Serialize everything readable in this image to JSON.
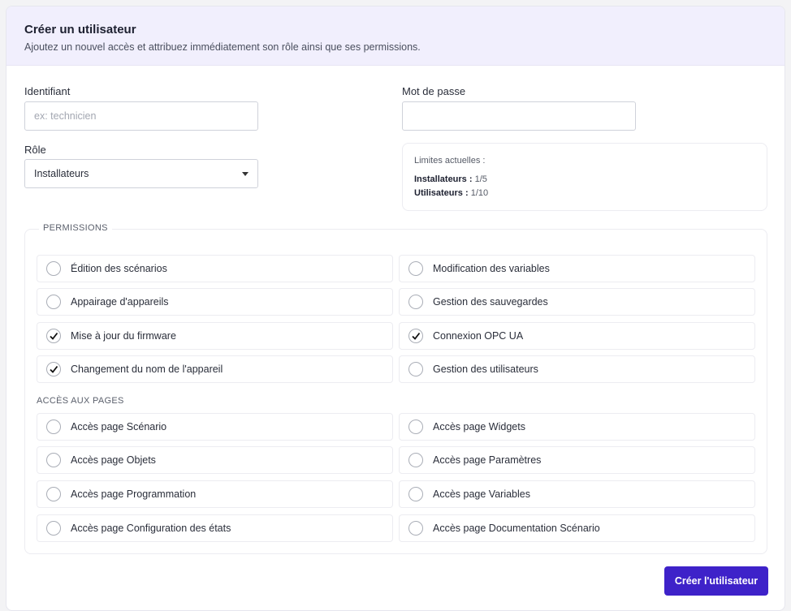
{
  "header": {
    "title": "Créer un utilisateur",
    "subtitle": "Ajoutez un nouvel accès et attribuez immédiatement son rôle ainsi que ses permissions."
  },
  "form": {
    "identifier_label": "Identifiant",
    "identifier_value": "",
    "identifier_placeholder": "ex: technicien",
    "password_label": "Mot de passe",
    "password_value": "",
    "role_label": "Rôle",
    "role_value": "Installateurs"
  },
  "limits": {
    "title": "Limites actuelles :",
    "rows": [
      {
        "label": "Installateurs :",
        "value": "1/5"
      },
      {
        "label": "Utilisateurs :",
        "value": "1/10"
      }
    ]
  },
  "permissions": {
    "title": "PERMISSIONS",
    "items": [
      {
        "label": "Édition des scénarios",
        "checked": false
      },
      {
        "label": "Modification des variables",
        "checked": false
      },
      {
        "label": "Appairage d'appareils",
        "checked": false
      },
      {
        "label": "Gestion des sauvegardes",
        "checked": false
      },
      {
        "label": "Mise à jour du firmware",
        "checked": true
      },
      {
        "label": "Connexion OPC UA",
        "checked": true
      },
      {
        "label": "Changement du nom de l'appareil",
        "checked": true
      },
      {
        "label": "Gestion des utilisateurs",
        "checked": false
      }
    ]
  },
  "pages": {
    "title": "ACCÈS AUX PAGES",
    "items": [
      {
        "label": "Accès page Scénario",
        "checked": false
      },
      {
        "label": "Accès page Widgets",
        "checked": false
      },
      {
        "label": "Accès page Objets",
        "checked": false
      },
      {
        "label": "Accès page Paramètres",
        "checked": false
      },
      {
        "label": "Accès page Programmation",
        "checked": false
      },
      {
        "label": "Accès page Variables",
        "checked": false
      },
      {
        "label": "Accès page Configuration des états",
        "checked": false
      },
      {
        "label": "Accès page Documentation Scénario",
        "checked": false
      }
    ]
  },
  "submit_label": "Créer l'utilisateur",
  "colors": {
    "accent": "#3e22c9",
    "header_bg": "#f1effd"
  },
  "icons": {
    "check": "checkmark-icon",
    "select": "caret-down-icon"
  }
}
